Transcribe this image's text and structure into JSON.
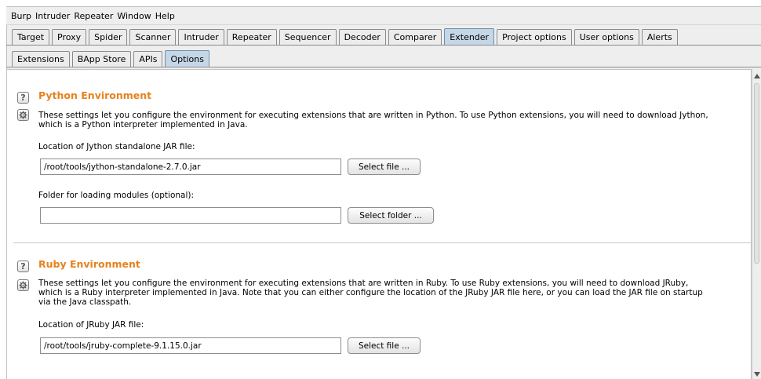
{
  "menubar": {
    "items": [
      "Burp",
      "Intruder",
      "Repeater",
      "Window",
      "Help"
    ]
  },
  "main_tabs": {
    "items": [
      "Target",
      "Proxy",
      "Spider",
      "Scanner",
      "Intruder",
      "Repeater",
      "Sequencer",
      "Decoder",
      "Comparer",
      "Extender",
      "Project options",
      "User options",
      "Alerts"
    ],
    "active": "Extender"
  },
  "sub_tabs": {
    "items": [
      "Extensions",
      "BApp Store",
      "APIs",
      "Options"
    ],
    "active": "Options"
  },
  "python": {
    "title": "Python Environment",
    "description_line1": "These settings let you configure the environment for executing extensions that are written in Python. To use Python extensions, you will need to download Jython,",
    "description_line2": "which is a Python interpreter implemented in Java.",
    "jar_label": "Location of Jython standalone JAR file:",
    "jar_value": "/root/tools/jython-standalone-2.7.0.jar",
    "jar_button": "Select file ...",
    "modules_label": "Folder for loading modules (optional):",
    "modules_value": "",
    "modules_button": "Select folder ..."
  },
  "ruby": {
    "title": "Ruby Environment",
    "description_line1": "These settings let you configure the environment for executing extensions that are written in Ruby. To use Ruby extensions, you will need to download JRuby,",
    "description_line2": "which is a Ruby interpreter implemented in Java. Note that you can either configure the location of the JRuby JAR file here, or you can load the JAR file on startup",
    "description_line3": "via the Java classpath.",
    "jar_label": "Location of JRuby JAR file:",
    "jar_value": "/root/tools/jruby-complete-9.1.15.0.jar",
    "jar_button": "Select file ..."
  },
  "icons": {
    "help": "?",
    "settings": "gear-icon"
  },
  "colors": {
    "section_title": "#e6821e",
    "active_tab": "#c5d7e7"
  }
}
